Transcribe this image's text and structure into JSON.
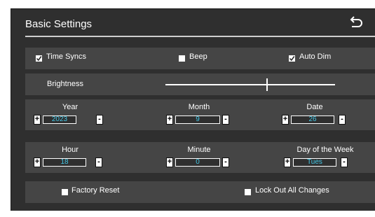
{
  "header": {
    "title": "Basic Settings",
    "back_icon": "back-arrow-icon"
  },
  "toggles": [
    {
      "label": "Time Syncs",
      "checked": true
    },
    {
      "label": "Beep",
      "checked": false
    },
    {
      "label": "Auto Dim",
      "checked": true
    }
  ],
  "brightness": {
    "label": "Brightness",
    "level_fraction": 0.6
  },
  "date_row": {
    "year": {
      "label": "Year",
      "value": "2023"
    },
    "month": {
      "label": "Month",
      "value": "9"
    },
    "date": {
      "label": "Date",
      "value": "26"
    }
  },
  "time_row": {
    "hour": {
      "label": "Hour",
      "value": "18"
    },
    "minute": {
      "label": "Minute",
      "value": "0"
    },
    "dow": {
      "label": "Day of the Week",
      "value": "Tues"
    }
  },
  "bottom": {
    "factory_reset": {
      "label": "Factory Reset",
      "checked": false
    },
    "lock_out": {
      "label": "Lock Out All Changes",
      "checked": false
    }
  },
  "spin": {
    "plus": "+",
    "minus": "-"
  },
  "colors": {
    "panel": "#2f2f2f",
    "row": "#454545",
    "value_text": "#43c7e6"
  }
}
